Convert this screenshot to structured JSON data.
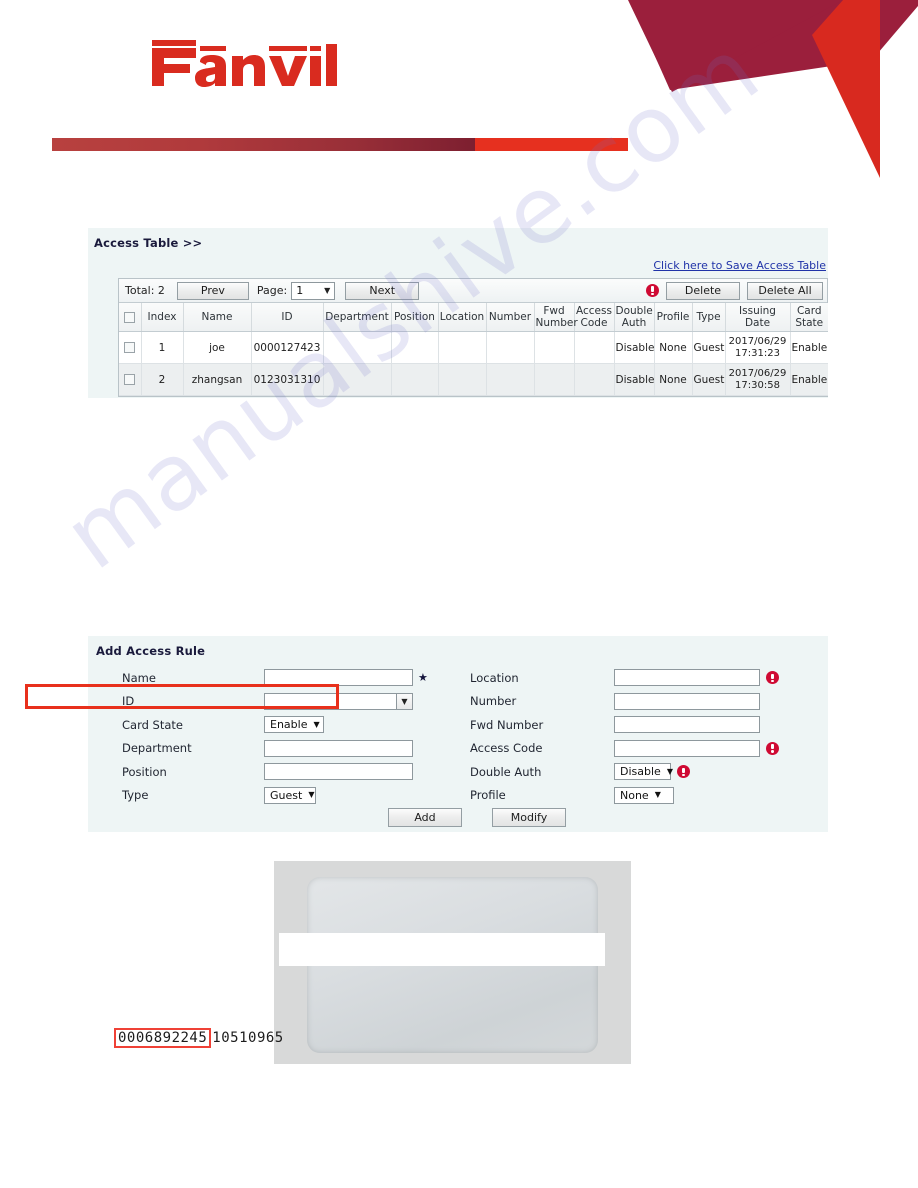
{
  "branding": {
    "logo_text": "Fanvil",
    "logo_color": "#d92b1f",
    "bar_dark_color": "#7d1f30",
    "bar_bright_color": "#e6301f",
    "deco_dark_color": "#9b1f3c",
    "deco_bright_color": "#d8291f"
  },
  "watermark": {
    "text": "manualshive.com"
  },
  "access_section": {
    "title": "Access Table >>",
    "save_link": "Click here to Save Access Table",
    "toolbar": {
      "total_label": "Total: 2",
      "prev_label": "Prev",
      "page_label": "Page:",
      "page_value": "1",
      "next_label": "Next",
      "delete_label": "Delete",
      "delete_all_label": "Delete All",
      "help_icon": "help-badge-icon",
      "caret_icon": "chevron-down-icon"
    },
    "columns": [
      "Index",
      "Name",
      "ID",
      "Department",
      "Position",
      "Location",
      "Number",
      "Fwd Number",
      "Access Code",
      "Double Auth",
      "Profile",
      "Type",
      "Issuing Date",
      "Card State"
    ],
    "rows": [
      {
        "index": "1",
        "name": "joe",
        "id": "0000127423",
        "department": "",
        "position": "",
        "location": "",
        "number": "",
        "fwd_number": "",
        "access_code": "",
        "double_auth": "Disable",
        "profile": "None",
        "type": "Guest",
        "issuing_date_1": "2017/06/29",
        "issuing_date_2": "17:31:23",
        "card_state": "Enable"
      },
      {
        "index": "2",
        "name": "zhangsan",
        "id": "0123031310",
        "department": "",
        "position": "",
        "location": "",
        "number": "",
        "fwd_number": "",
        "access_code": "",
        "double_auth": "Disable",
        "profile": "None",
        "type": "Guest",
        "issuing_date_1": "2017/06/29",
        "issuing_date_2": "17:30:58",
        "card_state": "Enable"
      }
    ]
  },
  "rule_section": {
    "title": "Add Access Rule",
    "left_fields": {
      "name_label": "Name",
      "name_value": "",
      "id_label": "ID",
      "id_value": "",
      "card_state_label": "Card State",
      "card_state_value": "Enable",
      "department_label": "Department",
      "department_value": "",
      "position_label": "Position",
      "position_value": "",
      "type_label": "Type",
      "type_value": "Guest"
    },
    "right_fields": {
      "location_label": "Location",
      "location_value": "",
      "number_label": "Number",
      "number_value": "",
      "fwd_number_label": "Fwd Number",
      "fwd_number_value": "",
      "access_code_label": "Access Code",
      "access_code_value": "",
      "double_auth_label": "Double Auth",
      "double_auth_value": "Disable",
      "profile_label": "Profile",
      "profile_value": "None"
    },
    "required_marker": "★",
    "caret_icon": "chevron-down-icon",
    "help_icon": "help-badge-icon",
    "highlight_color": "#e8301c",
    "add_label": "Add",
    "modify_label": "Modify"
  },
  "card_photo": {
    "number_highlighted": "0006892245",
    "number_rest": "10510965",
    "highlight_color": "#ef4136"
  }
}
